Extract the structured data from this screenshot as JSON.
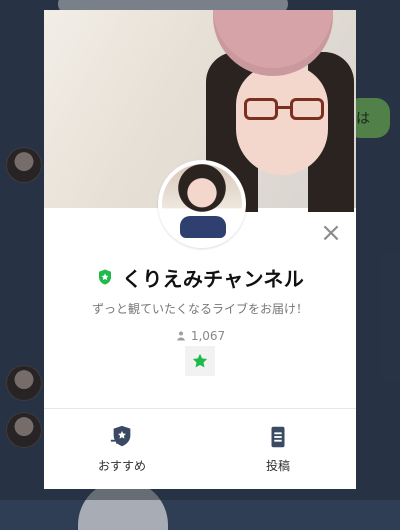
{
  "chat_background": {
    "visible_bubble_text": "は"
  },
  "profile_card": {
    "name": "くりえみチャンネル",
    "subtitle": "ずっと観ていたくなるライブをお届け！",
    "followers": "1,067",
    "close_symbol": "×",
    "actions": [
      {
        "label": "おすすめ",
        "icon": "share-recommend-icon"
      },
      {
        "label": "投稿",
        "icon": "post-document-icon"
      }
    ],
    "badges": {
      "verified": "green-shield-star",
      "favorite": "green-star"
    },
    "colors": {
      "green": "#1fba4b",
      "dark_icon": "#3a4a63"
    }
  }
}
